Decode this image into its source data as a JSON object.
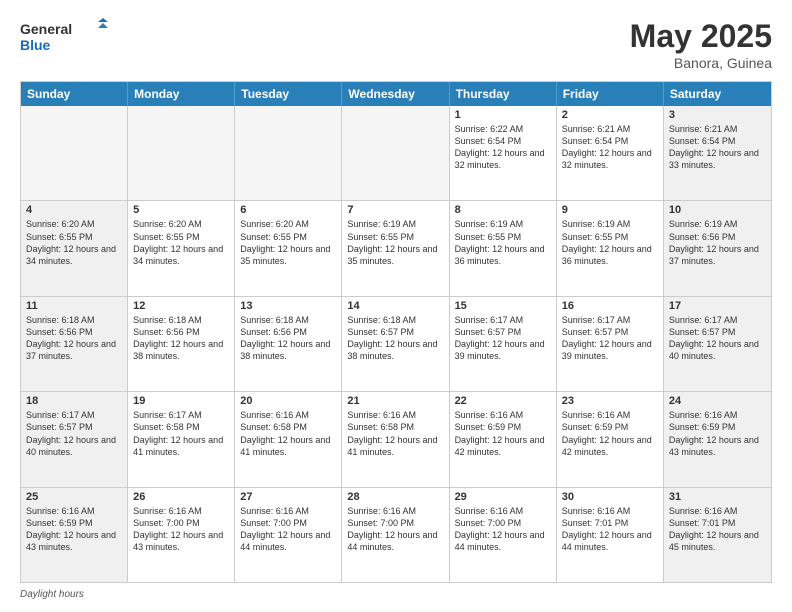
{
  "logo": {
    "general": "General",
    "blue": "Blue"
  },
  "title": "May 2025",
  "location": "Banora, Guinea",
  "days_of_week": [
    "Sunday",
    "Monday",
    "Tuesday",
    "Wednesday",
    "Thursday",
    "Friday",
    "Saturday"
  ],
  "footer_label": "Daylight hours",
  "weeks": [
    [
      {
        "day": "",
        "empty": true
      },
      {
        "day": "",
        "empty": true
      },
      {
        "day": "",
        "empty": true
      },
      {
        "day": "",
        "empty": true
      },
      {
        "day": "1",
        "sunrise": "6:22 AM",
        "sunset": "6:54 PM",
        "daylight": "12 hours and 32 minutes."
      },
      {
        "day": "2",
        "sunrise": "6:21 AM",
        "sunset": "6:54 PM",
        "daylight": "12 hours and 32 minutes."
      },
      {
        "day": "3",
        "sunrise": "6:21 AM",
        "sunset": "6:54 PM",
        "daylight": "12 hours and 33 minutes."
      }
    ],
    [
      {
        "day": "4",
        "sunrise": "6:20 AM",
        "sunset": "6:55 PM",
        "daylight": "12 hours and 34 minutes."
      },
      {
        "day": "5",
        "sunrise": "6:20 AM",
        "sunset": "6:55 PM",
        "daylight": "12 hours and 34 minutes."
      },
      {
        "day": "6",
        "sunrise": "6:20 AM",
        "sunset": "6:55 PM",
        "daylight": "12 hours and 35 minutes."
      },
      {
        "day": "7",
        "sunrise": "6:19 AM",
        "sunset": "6:55 PM",
        "daylight": "12 hours and 35 minutes."
      },
      {
        "day": "8",
        "sunrise": "6:19 AM",
        "sunset": "6:55 PM",
        "daylight": "12 hours and 36 minutes."
      },
      {
        "day": "9",
        "sunrise": "6:19 AM",
        "sunset": "6:55 PM",
        "daylight": "12 hours and 36 minutes."
      },
      {
        "day": "10",
        "sunrise": "6:19 AM",
        "sunset": "6:56 PM",
        "daylight": "12 hours and 37 minutes."
      }
    ],
    [
      {
        "day": "11",
        "sunrise": "6:18 AM",
        "sunset": "6:56 PM",
        "daylight": "12 hours and 37 minutes."
      },
      {
        "day": "12",
        "sunrise": "6:18 AM",
        "sunset": "6:56 PM",
        "daylight": "12 hours and 38 minutes."
      },
      {
        "day": "13",
        "sunrise": "6:18 AM",
        "sunset": "6:56 PM",
        "daylight": "12 hours and 38 minutes."
      },
      {
        "day": "14",
        "sunrise": "6:18 AM",
        "sunset": "6:57 PM",
        "daylight": "12 hours and 38 minutes."
      },
      {
        "day": "15",
        "sunrise": "6:17 AM",
        "sunset": "6:57 PM",
        "daylight": "12 hours and 39 minutes."
      },
      {
        "day": "16",
        "sunrise": "6:17 AM",
        "sunset": "6:57 PM",
        "daylight": "12 hours and 39 minutes."
      },
      {
        "day": "17",
        "sunrise": "6:17 AM",
        "sunset": "6:57 PM",
        "daylight": "12 hours and 40 minutes."
      }
    ],
    [
      {
        "day": "18",
        "sunrise": "6:17 AM",
        "sunset": "6:57 PM",
        "daylight": "12 hours and 40 minutes."
      },
      {
        "day": "19",
        "sunrise": "6:17 AM",
        "sunset": "6:58 PM",
        "daylight": "12 hours and 41 minutes."
      },
      {
        "day": "20",
        "sunrise": "6:16 AM",
        "sunset": "6:58 PM",
        "daylight": "12 hours and 41 minutes."
      },
      {
        "day": "21",
        "sunrise": "6:16 AM",
        "sunset": "6:58 PM",
        "daylight": "12 hours and 41 minutes."
      },
      {
        "day": "22",
        "sunrise": "6:16 AM",
        "sunset": "6:59 PM",
        "daylight": "12 hours and 42 minutes."
      },
      {
        "day": "23",
        "sunrise": "6:16 AM",
        "sunset": "6:59 PM",
        "daylight": "12 hours and 42 minutes."
      },
      {
        "day": "24",
        "sunrise": "6:16 AM",
        "sunset": "6:59 PM",
        "daylight": "12 hours and 43 minutes."
      }
    ],
    [
      {
        "day": "25",
        "sunrise": "6:16 AM",
        "sunset": "6:59 PM",
        "daylight": "12 hours and 43 minutes."
      },
      {
        "day": "26",
        "sunrise": "6:16 AM",
        "sunset": "7:00 PM",
        "daylight": "12 hours and 43 minutes."
      },
      {
        "day": "27",
        "sunrise": "6:16 AM",
        "sunset": "7:00 PM",
        "daylight": "12 hours and 44 minutes."
      },
      {
        "day": "28",
        "sunrise": "6:16 AM",
        "sunset": "7:00 PM",
        "daylight": "12 hours and 44 minutes."
      },
      {
        "day": "29",
        "sunrise": "6:16 AM",
        "sunset": "7:00 PM",
        "daylight": "12 hours and 44 minutes."
      },
      {
        "day": "30",
        "sunrise": "6:16 AM",
        "sunset": "7:01 PM",
        "daylight": "12 hours and 44 minutes."
      },
      {
        "day": "31",
        "sunrise": "6:16 AM",
        "sunset": "7:01 PM",
        "daylight": "12 hours and 45 minutes."
      }
    ]
  ]
}
